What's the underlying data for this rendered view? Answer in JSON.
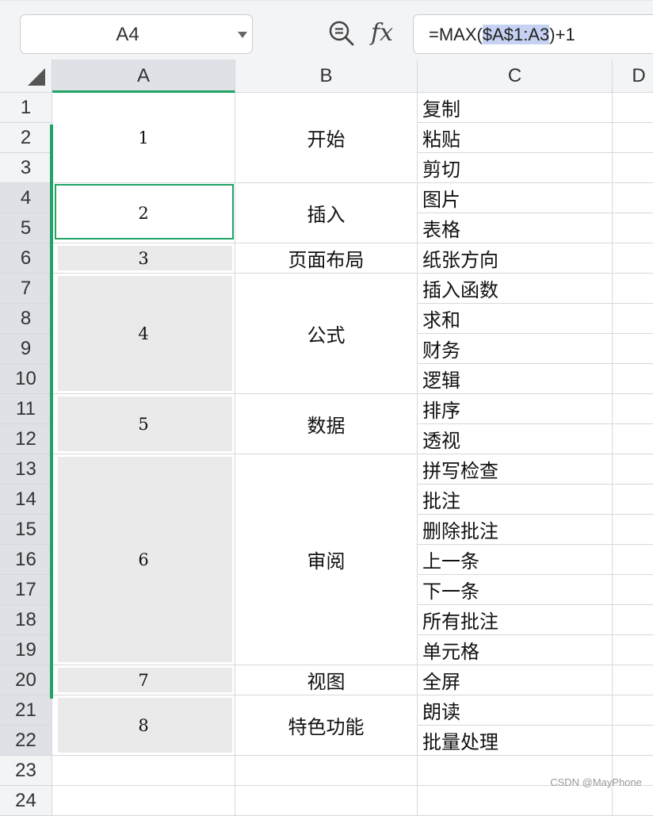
{
  "namebox": {
    "value": "A4"
  },
  "toolbar": {
    "zoom_icon": "zoom-formula-icon",
    "fx_label": "fx"
  },
  "formula": {
    "prefix": "=MAX(",
    "highlight": "$A$1:A3",
    "suffix": ")+1"
  },
  "columns": [
    "A",
    "B",
    "C",
    "D"
  ],
  "rows": [
    "1",
    "2",
    "3",
    "4",
    "5",
    "6",
    "7",
    "8",
    "9",
    "10",
    "11",
    "12",
    "13",
    "14",
    "15",
    "16",
    "17",
    "18",
    "19",
    "20",
    "21",
    "22",
    "23",
    "24"
  ],
  "colA": [
    "1",
    "2",
    "3",
    "4",
    "5",
    "6",
    "7",
    "8"
  ],
  "colB": [
    "开始",
    "插入",
    "页面布局",
    "公式",
    "数据",
    "审阅",
    "视图",
    "特色功能"
  ],
  "colC": [
    "复制",
    "粘贴",
    "剪切",
    "图片",
    "表格",
    "纸张方向",
    "插入函数",
    "求和",
    "财务",
    "逻辑",
    "排序",
    "透视",
    "拼写检查",
    "批注",
    "删除批注",
    "上一条",
    "下一条",
    "所有批注",
    "单元格",
    "全屏",
    "朗读",
    "批量处理"
  ],
  "watermark": "CSDN @MayPhone",
  "colors": {
    "accent": "#21a366",
    "highlight": "#c6d2f3"
  }
}
